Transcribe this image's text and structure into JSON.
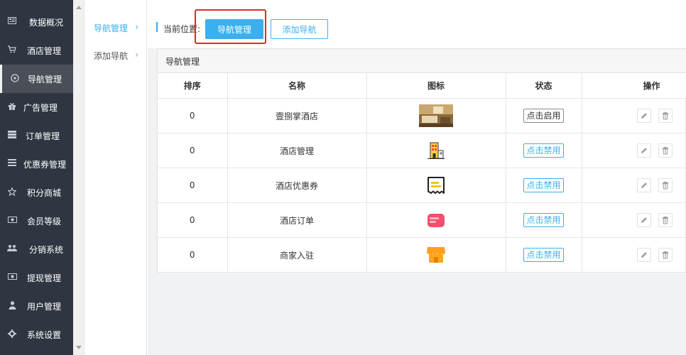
{
  "sidebar": {
    "items": [
      {
        "label": "数据概况",
        "icon": "dashboard-icon"
      },
      {
        "label": "酒店管理",
        "icon": "cart-icon"
      },
      {
        "label": "导航管理",
        "icon": "compass-icon"
      },
      {
        "label": "广告管理",
        "icon": "gift-icon"
      },
      {
        "label": "订单管理",
        "icon": "server-icon"
      },
      {
        "label": "优惠券管理",
        "icon": "menu-icon"
      },
      {
        "label": "积分商城",
        "icon": "star-icon"
      },
      {
        "label": "会员等级",
        "icon": "money-icon"
      },
      {
        "label": "分销系统",
        "icon": "users-icon"
      },
      {
        "label": "提现管理",
        "icon": "money-icon"
      },
      {
        "label": "用户管理",
        "icon": "user-icon"
      },
      {
        "label": "系统设置",
        "icon": "gear-icon"
      }
    ],
    "active_index": 2
  },
  "subnav": {
    "items": [
      {
        "label": "导航管理",
        "chevron": "›"
      },
      {
        "label": "添加导航",
        "chevron": "›"
      }
    ]
  },
  "breadcrumb": {
    "label": "当前位置:"
  },
  "buttons": {
    "primary": "导航管理",
    "secondary": "添加导航"
  },
  "panel": {
    "title": "导航管理"
  },
  "table": {
    "headers": [
      "排序",
      "名称",
      "图标",
      "状态",
      "操作"
    ],
    "rows": [
      {
        "order": "0",
        "name": "壹捌掌酒店",
        "icon": "hotel-room-photo",
        "status": "点击启用"
      },
      {
        "order": "0",
        "name": "酒店管理",
        "icon": "hotel-building-icon",
        "status": "点击禁用"
      },
      {
        "order": "0",
        "name": "酒店优惠券",
        "icon": "coupon-icon",
        "status": "点击禁用"
      },
      {
        "order": "0",
        "name": "酒店订单",
        "icon": "order-icon",
        "status": "点击禁用"
      },
      {
        "order": "0",
        "name": "商家入驻",
        "icon": "store-icon",
        "status": "点击禁用"
      }
    ]
  },
  "colors": {
    "accent": "#3ab0ee",
    "sidebar": "#2f3641",
    "highlight": "#e8242b"
  }
}
